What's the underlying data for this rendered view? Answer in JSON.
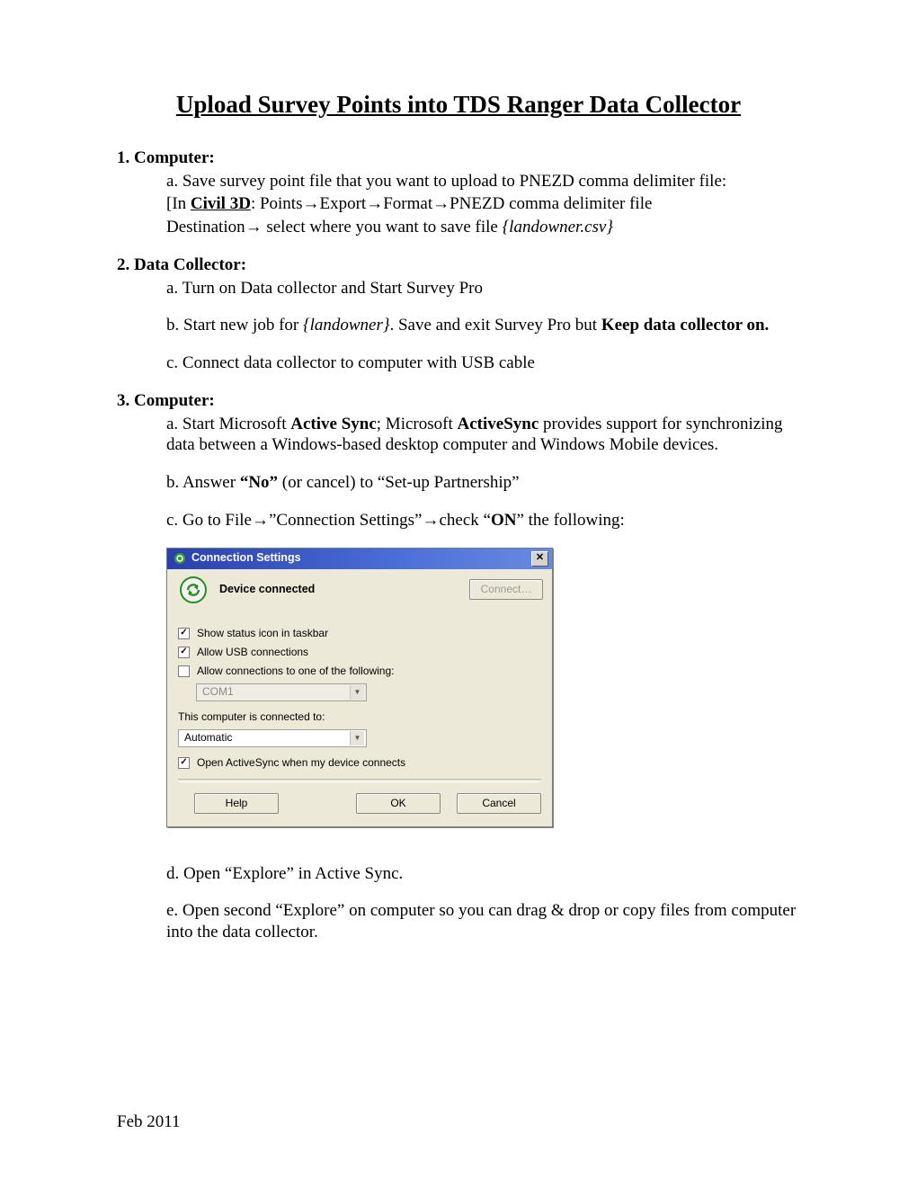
{
  "title": "Upload Survey Points into TDS  Ranger Data Collector",
  "footer_date": "Feb 2011",
  "s1": {
    "head": "1. Computer:",
    "a1": "a. Save survey point file that you want to upload to PNEZD comma delimiter file:",
    "in_prefix": " [In ",
    "civil3d": "Civil 3D",
    "in_rest": ": Points",
    "export": "Export",
    "format": "Format",
    "pnezd": "PNEZD  comma delimiter file",
    "dest": "Destination",
    "dest_rest": " select where you want to save file ",
    "dest_file": "{landowner.csv}"
  },
  "s2": {
    "head": "2. Data Collector:",
    "a": " a. Turn on Data collector and Start Survey Pro",
    "b1": " b. Start new job for ",
    "b_land": "{landowner}",
    "b2": ".   Save and exit Survey Pro but ",
    "b_bold": "Keep data collector on.",
    "c": "c. Connect data collector to computer with USB cable"
  },
  "s3": {
    "head": "3. Computer:",
    "a1": "a. Start Microsoft ",
    "a_as1": "Active Sync",
    "a2": "; Microsoft ",
    "a_as2": "ActiveSync",
    "a3": " provides support for synchronizing data between a Windows-based desktop computer and Windows Mobile devices.",
    "b1": "b. Answer ",
    "b_no": "“No”",
    "b2": " (or cancel) to “Set-up Partnership”",
    "c1": "c. Go to File",
    "c2": "”Connection Settings”",
    "c3": "check “",
    "c_on": "ON",
    "c4": "” the following:",
    "d": "d. Open “Explore” in Active Sync.",
    "e": "e. Open second “Explore” on computer so you can drag & drop or copy files from computer into the data collector."
  },
  "dialog": {
    "title": "Connection Settings",
    "status": "Device connected",
    "connect_btn": "Connect…",
    "chk_taskbar": "Show status icon in taskbar",
    "chk_usb": "Allow USB connections",
    "chk_allow_conn": "Allow connections to one of the following:",
    "com_value": "COM1",
    "connected_to_label": "This computer is connected to:",
    "connected_to_value": "Automatic",
    "chk_open_as": "Open ActiveSync when my device connects",
    "help": "Help",
    "ok": "OK",
    "cancel": "Cancel"
  },
  "arrow": "→"
}
